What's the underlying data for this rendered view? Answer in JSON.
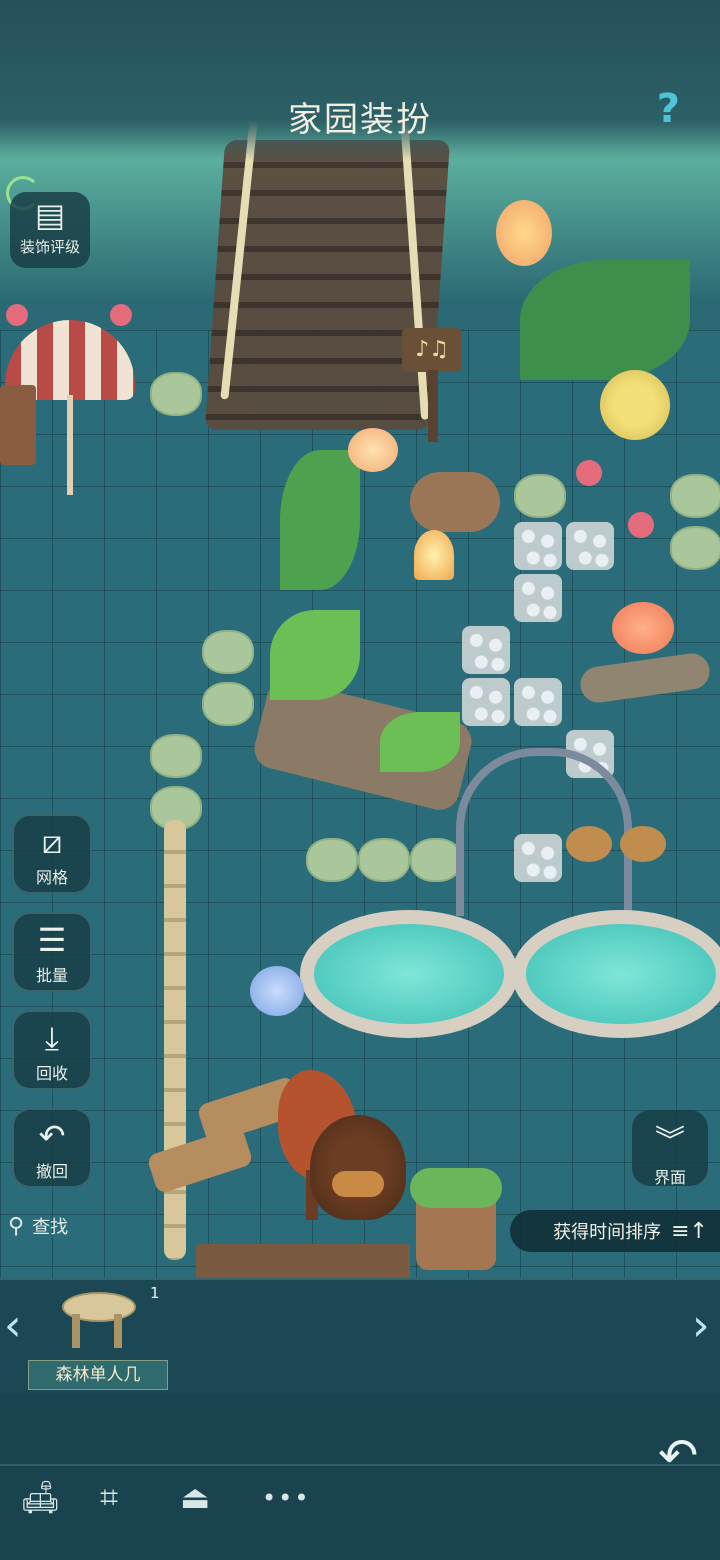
{
  "header": {
    "title": "家园装扮",
    "help_icon": "question-icon"
  },
  "left_toolbar": {
    "rating_label": "装饰评级",
    "grid_label": "网格",
    "batch_label": "批量",
    "recycle_label": "回收",
    "undo_label": "撤回"
  },
  "right_toolbar": {
    "ui_label": "界面"
  },
  "search": {
    "label": "查找"
  },
  "sort": {
    "label": "获得时间排序"
  },
  "inventory": {
    "items": [
      {
        "name": "森林单人几",
        "count": "1"
      }
    ]
  },
  "bottom_nav": {
    "icons": [
      "sofa-icon",
      "grid-tool-icon",
      "rug-icon",
      "more-icon"
    ],
    "more_text": "•••"
  },
  "colors": {
    "accent": "#4fc3d8",
    "panel": "#1a4350",
    "grid": "#2a6c79"
  }
}
